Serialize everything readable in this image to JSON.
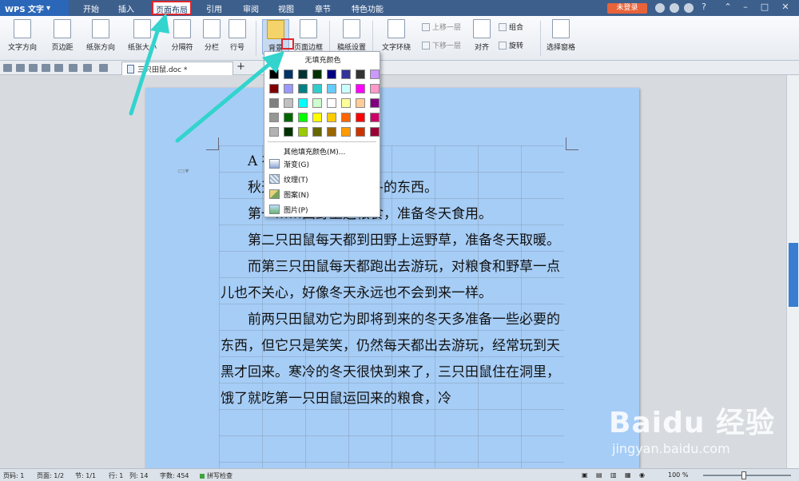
{
  "titlebar": {
    "app_name": "WPS 文字",
    "menus": [
      "开始",
      "插入",
      "页面布局",
      "引用",
      "审阅",
      "视图",
      "章节",
      "特色功能"
    ],
    "login": "未登录"
  },
  "ribbon": {
    "text_direction": "文字方向",
    "margins": "页边距",
    "orientation": "纸张方向",
    "paper_size": "纸张大小",
    "breaks": "分隔符",
    "columns": "分栏",
    "line_numbers": "行号",
    "background": "背景",
    "page_border": "页面边框",
    "manuscript": "稿纸设置",
    "wrap_text": "文字环绕",
    "bring_forward": "上移一层",
    "send_backward": "下移一层",
    "align": "对齐",
    "group": "组合",
    "rotate": "旋转",
    "selection_pane": "选择窗格"
  },
  "tabbar": {
    "doc_name": "三只田鼠.doc *",
    "new_tab": "+"
  },
  "document": {
    "paragraphs": [
      "A 在……只田鼠。",
      "秋天……开始准备过冬的东西。",
      "第一……田野上运粮食，准备冬天食用。",
      "第二只田鼠每天都到田野上运野草，准备冬天取暖。",
      "而第三只田鼠每天都跑出去游玩，对粮食和野草一点儿也不关心，好像冬天永远也不会到来一样。",
      "前两只田鼠劝它为即将到来的冬天多准备一些必要的东西，但它只是笑笑，仍然每天都出去游玩，经常玩到天黑才回来。寒冷的冬天很快到来了，三只田鼠住在洞里，饿了就吃第一只田鼠运回来的粮食，冷"
    ]
  },
  "dropdown": {
    "no_fill": "无填充颜色",
    "colors": [
      "#000000",
      "#003366",
      "#003333",
      "#003300",
      "#000080",
      "#333399",
      "#333333",
      "#cc99ff",
      "#800000",
      "#9999ff",
      "#008080",
      "#33cccc",
      "#66ccff",
      "#ccffff",
      "#ff00ff",
      "#ff99cc",
      "#808080",
      "#c0c0c0",
      "#00ffff",
      "#ccffcc",
      "#ffffff",
      "#ffff99",
      "#ffcc99",
      "#800080",
      "#969696",
      "#006600",
      "#00ff00",
      "#ffff00",
      "#ffcc00",
      "#ff6600",
      "#ff0000",
      "#cc0066",
      "#b2b2b2",
      "#003300",
      "#99cc00",
      "#666600",
      "#996600",
      "#ff9900",
      "#cc3300",
      "#990033"
    ],
    "more_colors": "其他填充颜色(M)...",
    "gradient": "渐变(G)",
    "texture": "纹理(T)",
    "pattern": "图案(N)",
    "picture": "图片(P)"
  },
  "statusbar": {
    "page_code": "页码: 1",
    "pages": "页面: 1/2",
    "section": "节: 1/1",
    "row": "行: 1",
    "col": "列: 14",
    "words": "字数: 454",
    "spell": "拼写检查",
    "zoom": "100 %"
  },
  "watermark": {
    "logo": "Baidu 经验",
    "url": "jingyan.baidu.com"
  },
  "colors": {
    "page_background": "#a6cdf6",
    "annotation_arrow": "#32d4cd",
    "highlight_box": "#e0262e"
  }
}
